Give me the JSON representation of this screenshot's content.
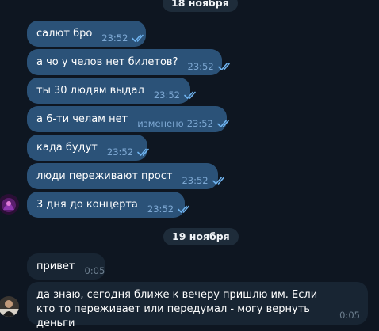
{
  "dates": {
    "first": "18 ноября",
    "second": "19 ноября"
  },
  "messages": [
    {
      "text": "салют бро",
      "time": "23:52",
      "direction": "out",
      "status": "read"
    },
    {
      "text": "а чо у челов нет билетов?",
      "time": "23:52",
      "direction": "out",
      "status": "read"
    },
    {
      "text": "ты 30 людям выдал",
      "time": "23:52",
      "direction": "out",
      "status": "read"
    },
    {
      "text": "а 6-ти челам нет",
      "edited": "изменено",
      "time": "23:52",
      "direction": "out",
      "status": "read"
    },
    {
      "text": "када будут",
      "time": "23:52",
      "direction": "out",
      "status": "read"
    },
    {
      "text": "люди переживают прост",
      "time": "23:52",
      "direction": "out",
      "status": "read"
    },
    {
      "text": "3 дня до концерта",
      "time": "23:52",
      "direction": "out",
      "status": "read"
    },
    {
      "text": "привет",
      "time": "0:05",
      "direction": "in"
    },
    {
      "text": "да знаю, сегодня ближе к вечеру пришлю им. Если кто то переживает или передумал - могу вернуть деньги",
      "time": "0:05",
      "direction": "in"
    }
  ],
  "colors": {
    "background": "#0e1621",
    "outgoing_bubble": "#2b5278",
    "incoming_bubble": "#182533",
    "date_pill": "#1e2c3a",
    "check_marks": "#6fb3ef"
  },
  "icons": [
    "double-check-icon",
    "sender-avatar",
    "contact-avatar"
  ]
}
